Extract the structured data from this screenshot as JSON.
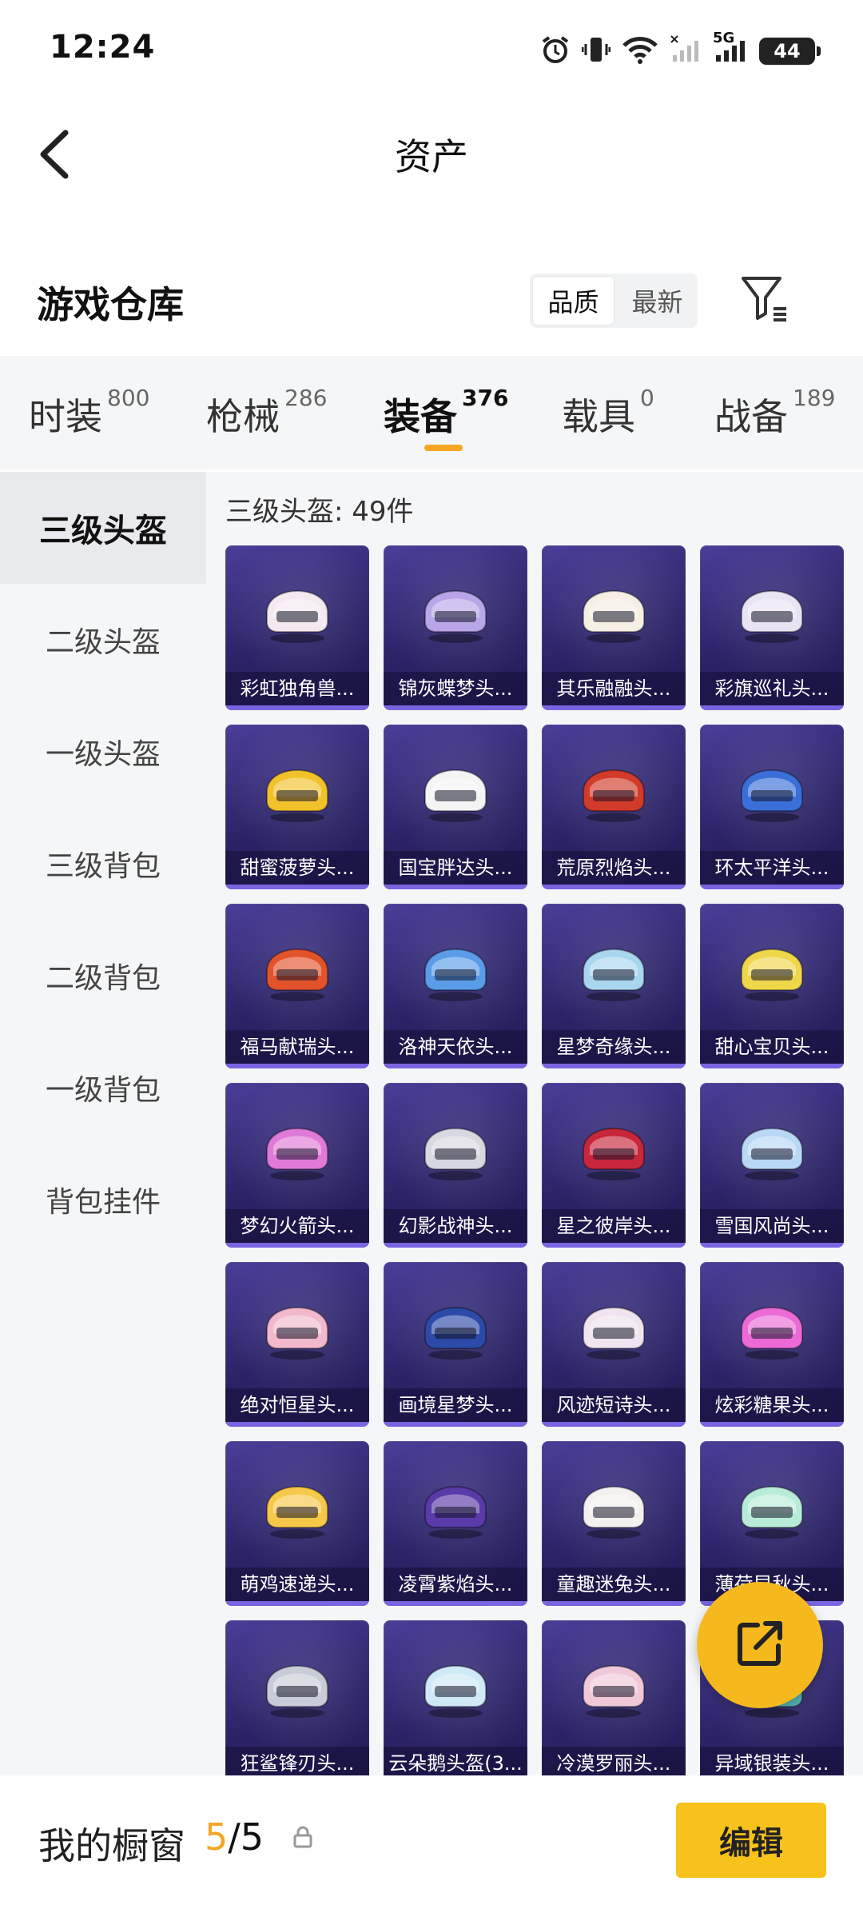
{
  "status_bar": {
    "time": "12:24",
    "network": "5G",
    "battery": "44"
  },
  "header": {
    "title": "资产",
    "icons": [
      "back-arrow-icon"
    ]
  },
  "warehouse": {
    "title": "游戏仓库",
    "sort_options": [
      {
        "label": "品质",
        "active": true
      },
      {
        "label": "最新",
        "active": false
      }
    ],
    "filter_icon": "filter-icon"
  },
  "category_tabs": [
    {
      "label": "时装",
      "count": "800",
      "active": false
    },
    {
      "label": "枪械",
      "count": "286",
      "active": false
    },
    {
      "label": "装备",
      "count": "376",
      "active": true
    },
    {
      "label": "载具",
      "count": "0",
      "active": false
    },
    {
      "label": "战备",
      "count": "189",
      "active": false
    }
  ],
  "sidebar": {
    "items": [
      {
        "label": "三级头盔",
        "active": true
      },
      {
        "label": "二级头盔",
        "active": false
      },
      {
        "label": "一级头盔",
        "active": false
      },
      {
        "label": "三级背包",
        "active": false
      },
      {
        "label": "二级背包",
        "active": false
      },
      {
        "label": "一级背包",
        "active": false
      },
      {
        "label": "背包挂件",
        "active": false
      }
    ]
  },
  "content": {
    "count_label": "三级头盔: 49件",
    "items": [
      {
        "name": "彩虹独角兽...",
        "color": "#f3e9ef"
      },
      {
        "name": "锦灰蝶梦头...",
        "color": "#b9a6e8"
      },
      {
        "name": "其乐融融头...",
        "color": "#f5efe4"
      },
      {
        "name": "彩旗巡礼头...",
        "color": "#e9e4f3"
      },
      {
        "name": "甜蜜菠萝头...",
        "color": "#f2c22a"
      },
      {
        "name": "国宝胖达头...",
        "color": "#f4f4f4"
      },
      {
        "name": "荒原烈焰头...",
        "color": "#d23a2a"
      },
      {
        "name": "环太平洋头...",
        "color": "#3a6ed8"
      },
      {
        "name": "福马献瑞头...",
        "color": "#e2532c"
      },
      {
        "name": "洛神天依头...",
        "color": "#5a9ce8"
      },
      {
        "name": "星梦奇缘头...",
        "color": "#a8d6ee"
      },
      {
        "name": "甜心宝贝头...",
        "color": "#f0d64a"
      },
      {
        "name": "梦幻火箭头...",
        "color": "#e07ad8"
      },
      {
        "name": "幻影战神头...",
        "color": "#d8d8e0"
      },
      {
        "name": "星之彼岸头...",
        "color": "#c8263a"
      },
      {
        "name": "雪国风尚头...",
        "color": "#b8d8f4"
      },
      {
        "name": "绝对恒星头...",
        "color": "#f2b8cc"
      },
      {
        "name": "画境星梦头...",
        "color": "#2e4aa8"
      },
      {
        "name": "风迹短诗头...",
        "color": "#efe4ef"
      },
      {
        "name": "炫彩糖果头...",
        "color": "#ec6ad6"
      },
      {
        "name": "萌鸡速递头...",
        "color": "#f6c84a"
      },
      {
        "name": "凌霄紫焰头...",
        "color": "#5a3aa8"
      },
      {
        "name": "童趣迷兔头...",
        "color": "#f4f0f0"
      },
      {
        "name": "薄荷早秋头...",
        "color": "#b8ecd8"
      },
      {
        "name": "狂鲨锋刃头...",
        "color": "#c8ccd8"
      },
      {
        "name": "云朵鹅头盔(3...",
        "color": "#cfe9f6"
      },
      {
        "name": "冷漠罗丽头...",
        "color": "#f0c8d8"
      },
      {
        "name": "异域银装头...",
        "color": "#5ab8b8"
      }
    ]
  },
  "fab": {
    "icon": "share-external-icon"
  },
  "bottom_bar": {
    "label": "我的橱窗",
    "current": "5",
    "total": "/5",
    "lock_icon": "lock-icon",
    "edit_label": "编辑"
  },
  "colors": {
    "accent": "#f5a623",
    "card_bg": "#2b2367",
    "edit_button": "#f8c21c"
  }
}
